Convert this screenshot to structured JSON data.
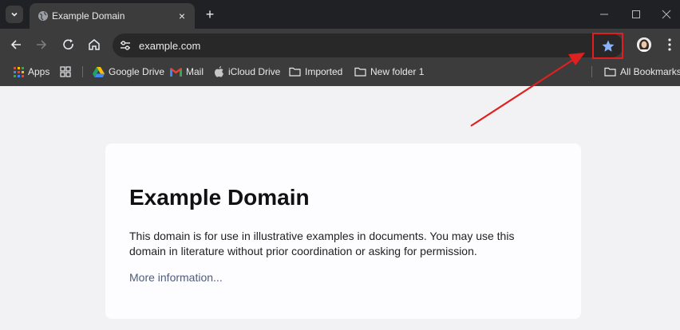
{
  "tab": {
    "title": "Example Domain",
    "close_glyph": "×"
  },
  "toolbar": {
    "new_tab_glyph": "+"
  },
  "omnibox": {
    "url": "example.com"
  },
  "bookmarks": {
    "apps": "Apps",
    "google_drive": "Google Drive",
    "mail": "Mail",
    "icloud": "iCloud Drive",
    "imported": "Imported",
    "new_folder": "New folder 1",
    "all": "All Bookmarks"
  },
  "page": {
    "heading": "Example Domain",
    "body": "This domain is for use in illustrative examples in documents. You may use this domain in literature without prior coordination or asking for permission.",
    "link": "More information..."
  },
  "colors": {
    "highlight": "#e02020",
    "star": "#8ab4f8",
    "link": "#4e5c7a"
  },
  "icons": [
    "chevron-down-icon",
    "globe-icon",
    "close-icon",
    "plus-icon",
    "minimize-icon",
    "maximize-icon",
    "window-close-icon",
    "back-icon",
    "forward-icon",
    "reload-icon",
    "home-icon",
    "tune-icon",
    "star-icon",
    "avatar",
    "more-vert-icon",
    "apps-grid-icon",
    "tab-groups-icon",
    "google-drive-icon",
    "gmail-icon",
    "apple-icon",
    "folder-icon",
    "annotation-arrow"
  ]
}
